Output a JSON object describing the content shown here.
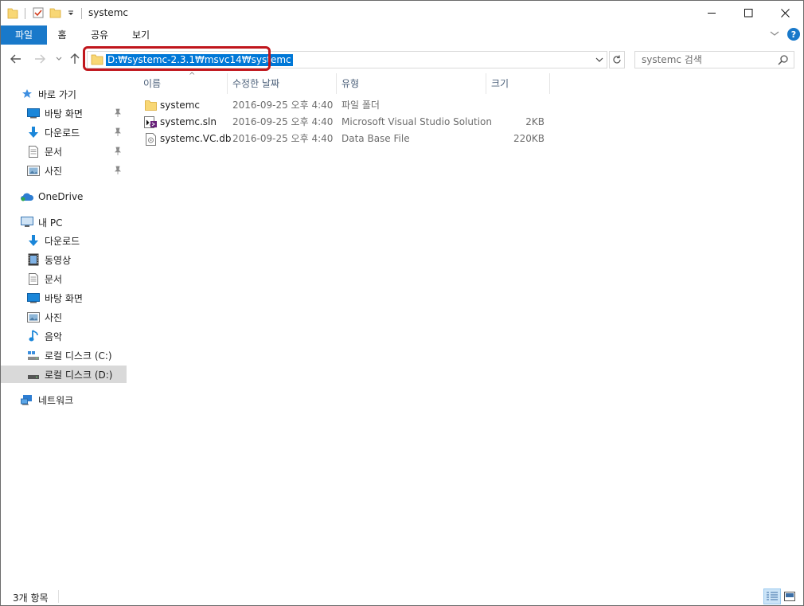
{
  "window": {
    "title": "systemc"
  },
  "ribbon": {
    "tabs": [
      {
        "label": "파일"
      },
      {
        "label": "홈"
      },
      {
        "label": "공유"
      },
      {
        "label": "보기"
      }
    ],
    "help_label": "?"
  },
  "address": {
    "path": "D:₩systemc-2.3.1₩msvc14₩systemc"
  },
  "search": {
    "placeholder": "systemc 검색"
  },
  "nav": {
    "quick_access": "바로 가기",
    "quick_items": [
      {
        "label": "바탕 화면",
        "icon": "desktop-icon"
      },
      {
        "label": "다운로드",
        "icon": "download-icon"
      },
      {
        "label": "문서",
        "icon": "document-icon"
      },
      {
        "label": "사진",
        "icon": "pictures-icon"
      }
    ],
    "onedrive": "OneDrive",
    "this_pc": "내 PC",
    "pc_items": [
      {
        "label": "다운로드",
        "icon": "download-icon"
      },
      {
        "label": "동영상",
        "icon": "video-icon"
      },
      {
        "label": "문서",
        "icon": "document-icon"
      },
      {
        "label": "바탕 화면",
        "icon": "desktop-icon"
      },
      {
        "label": "사진",
        "icon": "pictures-icon"
      },
      {
        "label": "음악",
        "icon": "music-icon"
      },
      {
        "label": "로컬 디스크 (C:)",
        "icon": "drive-icon"
      },
      {
        "label": "로컬 디스크 (D:)",
        "icon": "drive-icon"
      }
    ],
    "network": "네트워크"
  },
  "columns": {
    "name": "이름",
    "date": "수정한 날짜",
    "type": "유형",
    "size": "크기"
  },
  "files": [
    {
      "name": "systemc",
      "date": "2016-09-25 오후 4:40",
      "type": "파일 폴더",
      "size": "",
      "icon": "folder-icon"
    },
    {
      "name": "systemc.sln",
      "date": "2016-09-25 오후 4:40",
      "type": "Microsoft Visual Studio Solution",
      "size": "2KB",
      "icon": "vs-solution-icon"
    },
    {
      "name": "systemc.VC.db",
      "date": "2016-09-25 오후 4:40",
      "type": "Data Base File",
      "size": "220KB",
      "icon": "db-file-icon"
    }
  ],
  "status": {
    "count": "3개 항목"
  },
  "colors": {
    "accent": "#1979ca",
    "selection": "#0078d7",
    "highlight_box": "#c0161c"
  }
}
